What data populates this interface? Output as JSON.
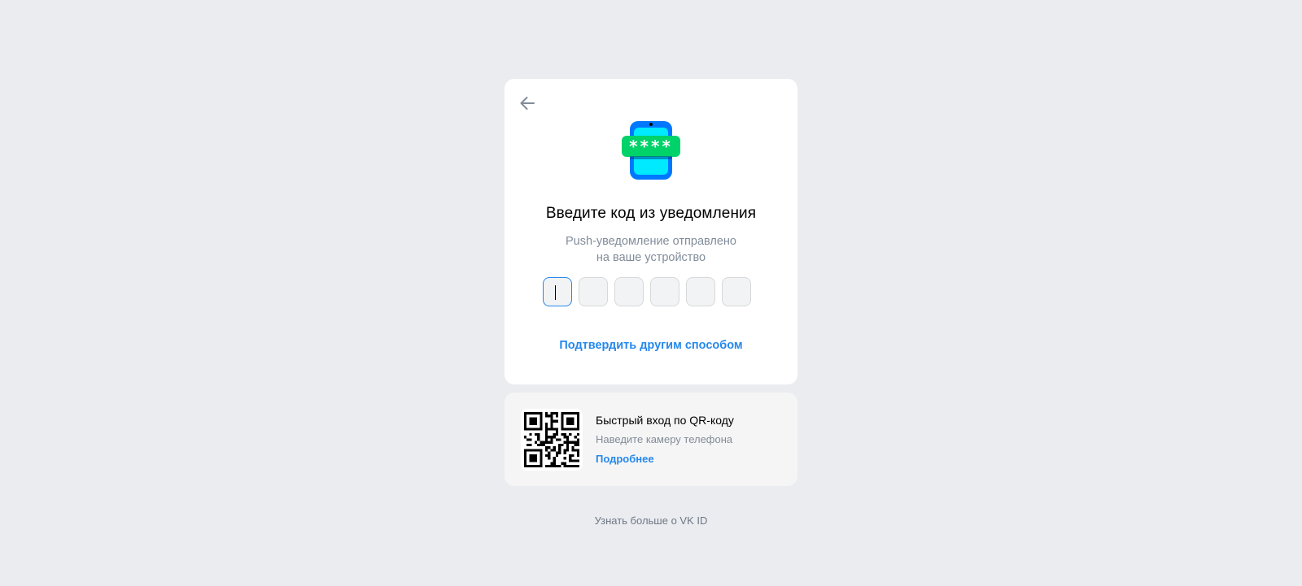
{
  "card": {
    "back_icon": "arrow-left-icon",
    "illustration_icon": "phone-password-icon",
    "illustration_text": "****",
    "title": "Введите код из уведомления",
    "subtitle_line1": "Push-уведомление отправлено",
    "subtitle_line2": "на ваше устройство",
    "code_cells": [
      "",
      "",
      "",
      "",
      "",
      ""
    ],
    "alt_link": "Подтвердить другим способом"
  },
  "qr": {
    "icon": "qr-code-icon",
    "title": "Быстрый вход по QR-коду",
    "subtitle": "Наведите камеру телефона",
    "more_link": "Подробнее"
  },
  "footer": {
    "link": "Узнать больше о VK ID"
  },
  "colors": {
    "background": "#ebecf0",
    "accent": "#2688eb",
    "secondary_text": "#818c99",
    "illustration_phone": "#0077ff",
    "illustration_screen": "#00eaff",
    "illustration_badge": "#00d26a"
  }
}
